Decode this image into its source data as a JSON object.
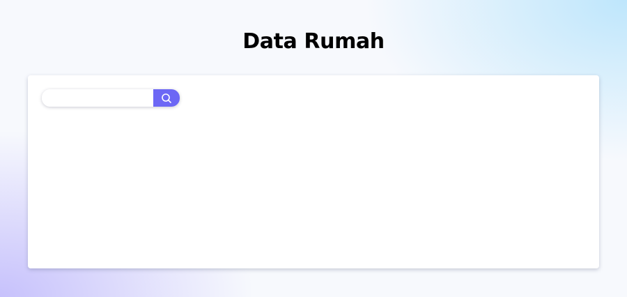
{
  "page": {
    "title": "Data Rumah"
  },
  "search": {
    "value": "",
    "placeholder": "",
    "button_icon": "search-icon"
  },
  "colors": {
    "accent": "#6c67f5",
    "card_background": "#ffffff",
    "title_text": "#000000"
  }
}
